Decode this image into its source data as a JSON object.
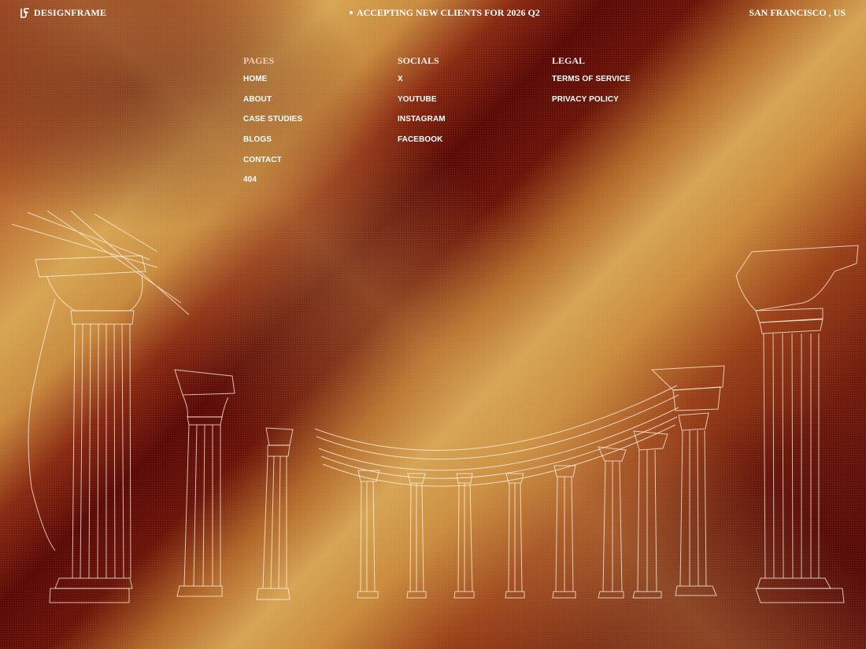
{
  "header": {
    "brand": "DESIGNFRAME",
    "announcement": "ACCEPTING NEW CLIENTS FOR 2026 Q2",
    "location": "SAN FRANCISCO , US"
  },
  "nav": {
    "pages": {
      "title": "PAGES",
      "items": [
        "HOME",
        "ABOUT",
        "CASE STUDIES",
        "BLOGS",
        "CONTACT",
        "404"
      ]
    },
    "socials": {
      "title": "SOCIALS",
      "items": [
        "X",
        "YOUTUBE",
        "INSTAGRAM",
        "FACEBOOK"
      ]
    },
    "legal": {
      "title": "LEGAL",
      "items": [
        "TERMS OF SERVICE",
        "PRIVACY POLICY"
      ]
    }
  },
  "colors": {
    "dark_maroon": "#5a0a06",
    "gold": "#d7a552",
    "text": "#ffffff"
  },
  "icons": {
    "logo": "df-monogram-icon",
    "announcement": "bullet-dot-icon",
    "illustration": "greek-columns-line-art"
  }
}
